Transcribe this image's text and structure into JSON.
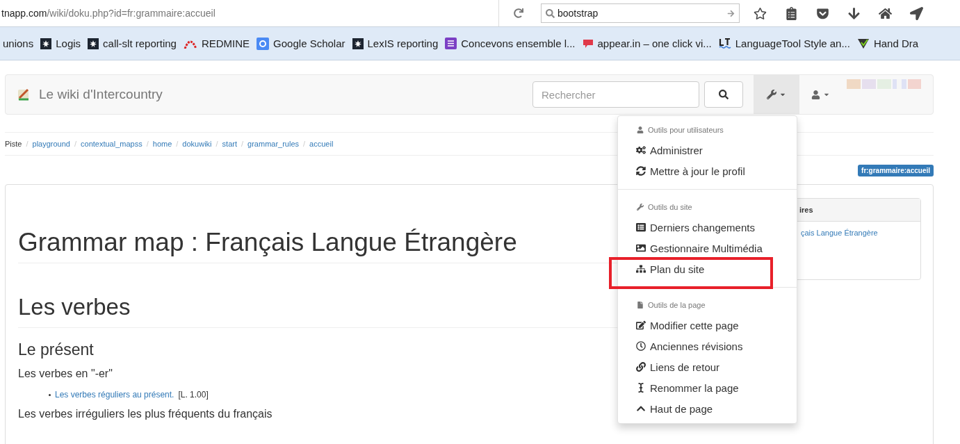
{
  "browser": {
    "url_host": "tnapp.com",
    "url_path": "/wiki/doku.php?id=fr:grammaire:accueil",
    "search_value": "bootstrap"
  },
  "bookmarks": [
    "unions",
    "Logis",
    "call-slt reporting",
    "REDMINE",
    "Google Scholar",
    "LexIS reporting",
    "Concevons ensemble l...",
    "appear.in – one click vi...",
    "LanguageTool Style an...",
    "Hand Dra"
  ],
  "navbar": {
    "title": "Le wiki d'Intercountry",
    "search_placeholder": "Rechercher",
    "tools_open": true
  },
  "breadcrumb": {
    "label": "Piste",
    "separator": "/",
    "links": [
      "playground",
      "contextual_mapss",
      "home",
      "dokuwiki",
      "start",
      "grammar_rules",
      "accueil"
    ]
  },
  "page_id_badge": "fr:grammaire:accueil",
  "sidebar_panel": {
    "heading": "ires",
    "links": [
      "çais Langue Étrangère"
    ]
  },
  "content": [
    {
      "kind": "h1",
      "text": "Grammar map : Français Langue Étrangère"
    },
    {
      "kind": "h2",
      "text": "Les verbes"
    },
    {
      "kind": "h3",
      "text": "Le présent"
    },
    {
      "kind": "p",
      "text": "Les verbes en \"-er\""
    },
    {
      "kind": "li",
      "link": "Les verbes réguliers au présent.",
      "note": "[L. 1.00]"
    },
    {
      "kind": "p",
      "text": "Les verbes irréguliers les plus fréquents du français"
    }
  ],
  "tools_menu": {
    "sections": [
      {
        "heading": "Outils pour utilisateurs",
        "items": [
          {
            "label": "Administrer",
            "highlighted": false
          },
          {
            "label": "Mettre à jour le profil",
            "highlighted": false
          }
        ]
      },
      {
        "heading": "Outils du site",
        "items": [
          {
            "label": "Derniers changements",
            "highlighted": false
          },
          {
            "label": "Gestionnaire Multimédia",
            "highlighted": false
          },
          {
            "label": "Plan du site",
            "highlighted": true
          }
        ]
      },
      {
        "heading": "Outils de la page",
        "items": [
          {
            "label": "Modifier cette page",
            "highlighted": false
          },
          {
            "label": "Anciennes révisions",
            "highlighted": false
          },
          {
            "label": "Liens de retour",
            "highlighted": false
          },
          {
            "label": "Renommer la page",
            "highlighted": false
          },
          {
            "label": "Haut de page",
            "highlighted": false
          }
        ]
      }
    ]
  }
}
